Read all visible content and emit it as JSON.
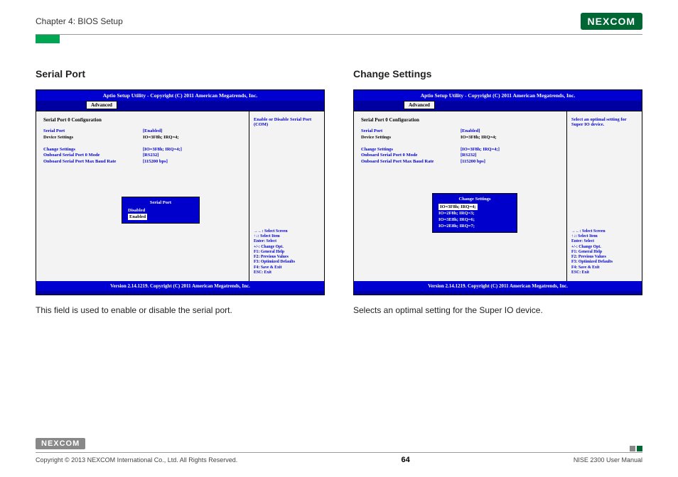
{
  "header": {
    "chapter": "Chapter 4: BIOS Setup",
    "brand": "NEXCOM"
  },
  "left": {
    "heading": "Serial Port",
    "bios_title": "Aptio Setup Utility - Copyright (C) 2011 American Megatrends, Inc.",
    "tab": "Advanced",
    "cfg_head": "Serial Port 0 Configuration",
    "rows": {
      "sp_lbl": "Serial Port",
      "sp_val": "[Enabled]",
      "ds_lbl": "Device Settings",
      "ds_val": "IO=3F8h; IRQ=4;",
      "cs_lbl": "Change Settings",
      "cs_val": "[IO=3F8h; IRQ=4;]",
      "mode_lbl": "Onboard Serial Port 0 Mode",
      "mode_val": "[RS232]",
      "baud_lbl": "Onboard Serial Port Max Baud Rate",
      "baud_val": "[115200 bps]"
    },
    "popup": {
      "title": "Serial Port",
      "opt1": "Disabled",
      "opt2": "Enabled"
    },
    "help": "Enable or Disable Serial Port (COM)",
    "keys": {
      "k1": "→←: Select Screen",
      "k2": "↑↓: Select Item",
      "k3": "Enter: Select",
      "k4": "+/-: Change Opt.",
      "k5": "F1: General Help",
      "k6": "F2: Previous Values",
      "k7": "F3: Optimized Defaults",
      "k8": "F4: Save & Exit",
      "k9": "ESC: Exit"
    },
    "bios_footer": "Version 2.14.1219. Copyright (C) 2011 American Megatrends, Inc.",
    "caption": "This field is used to enable or disable the serial port."
  },
  "right": {
    "heading": "Change Settings",
    "bios_title": "Aptio Setup Utility - Copyright (C) 2011 American Megatrends, Inc.",
    "tab": "Advanced",
    "cfg_head": "Serial Port 0 Configuration",
    "rows": {
      "sp_lbl": "Serial Port",
      "sp_val": "[Enabled]",
      "ds_lbl": "Device Settings",
      "ds_val": "IO=3F8h; IRQ=4;",
      "cs_lbl": "Change Settings",
      "cs_val": "[IO=3F8h; IRQ=4;]",
      "mode_lbl": "Onboard Serial Port 0 Mode",
      "mode_val": "[RS232]",
      "baud_lbl": "Onboard Serial Port Max Baud Rate",
      "baud_val": "[115200 bps]"
    },
    "popup": {
      "title": "Change Settings",
      "o1": "IO=3F8h; IRQ=4;",
      "o2": "IO=2F8h; IRQ=3;",
      "o3": "IO=3E8h; IRQ=6;",
      "o4": "IO=2E8h; IRQ=7;"
    },
    "help": "Select an optimal setting for Super IO device.",
    "keys": {
      "k1": "→←: Select Screen",
      "k2": "↑↓: Select Item",
      "k3": "Enter: Select",
      "k4": "+/-: Change Opt.",
      "k5": "F1: General Help",
      "k6": "F2: Previous Values",
      "k7": "F3: Optimized Defaults",
      "k8": "F4: Save & Exit",
      "k9": "ESC: Exit"
    },
    "bios_footer": "Version 2.14.1219. Copyright (C) 2011 American Megatrends, Inc.",
    "caption": "Selects an optimal setting for the Super IO device."
  },
  "footer": {
    "brand": "NEXCOM",
    "copyright": "Copyright © 2013 NEXCOM International Co., Ltd. All Rights Reserved.",
    "page": "64",
    "manual": "NISE 2300 User Manual"
  }
}
